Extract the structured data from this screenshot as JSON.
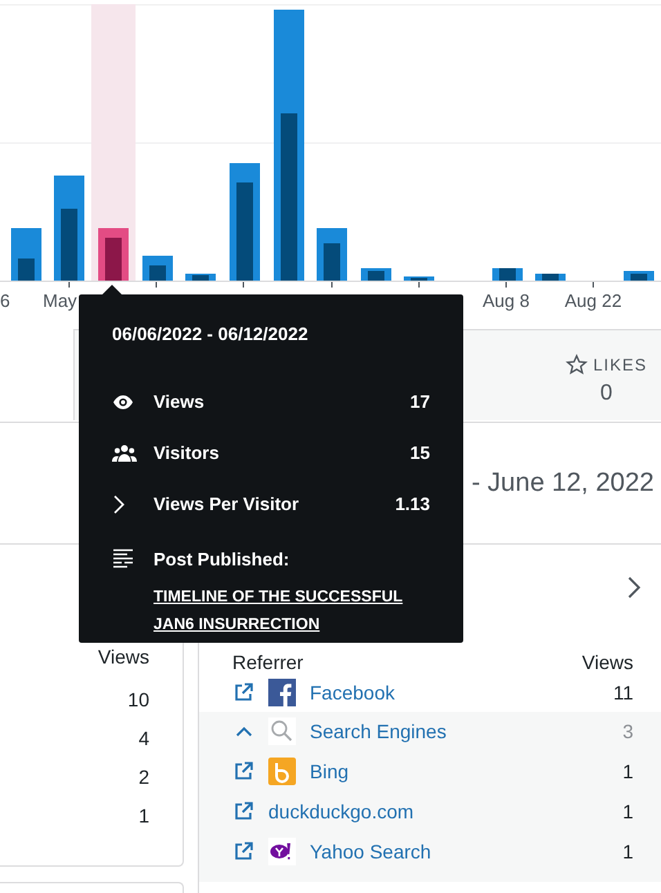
{
  "chart": {
    "x_labels": [
      {
        "label": "6"
      },
      {
        "label": "May"
      },
      {
        "label": "Aug 8"
      },
      {
        "label": "Aug 22"
      }
    ]
  },
  "likes": {
    "label": "LIKES",
    "value": "0"
  },
  "period_title": "- June 12, 2022",
  "countries": {
    "column": "Views",
    "values": [
      "10",
      "4",
      "2",
      "1"
    ]
  },
  "referrers": {
    "columns": [
      "Referrer",
      "Views"
    ],
    "rows": [
      {
        "kind": "facebook",
        "name": "Facebook",
        "views": "11"
      },
      {
        "kind": "group",
        "name": "Search Engines",
        "views": "3",
        "expanded": true,
        "children": [
          {
            "kind": "bing",
            "name": "Bing",
            "views": "1"
          },
          {
            "kind": "plain",
            "name": "duckduckgo.com",
            "views": "1"
          },
          {
            "kind": "yahoo",
            "name": "Yahoo Search",
            "views": "1"
          }
        ]
      }
    ]
  },
  "tooltip": {
    "date": "06/06/2022 - 06/12/2022",
    "stats": [
      {
        "kind": "views",
        "label": "Views",
        "value": "17"
      },
      {
        "kind": "visitors",
        "label": "Visitors",
        "value": "15"
      },
      {
        "kind": "ratio",
        "label": "Views Per Visitor",
        "value": "1.13"
      }
    ],
    "post_heading": "Post Published:",
    "post_link": "TIMELINE OF THE SUCCESSFUL JAN6 INSURRECTION"
  }
}
